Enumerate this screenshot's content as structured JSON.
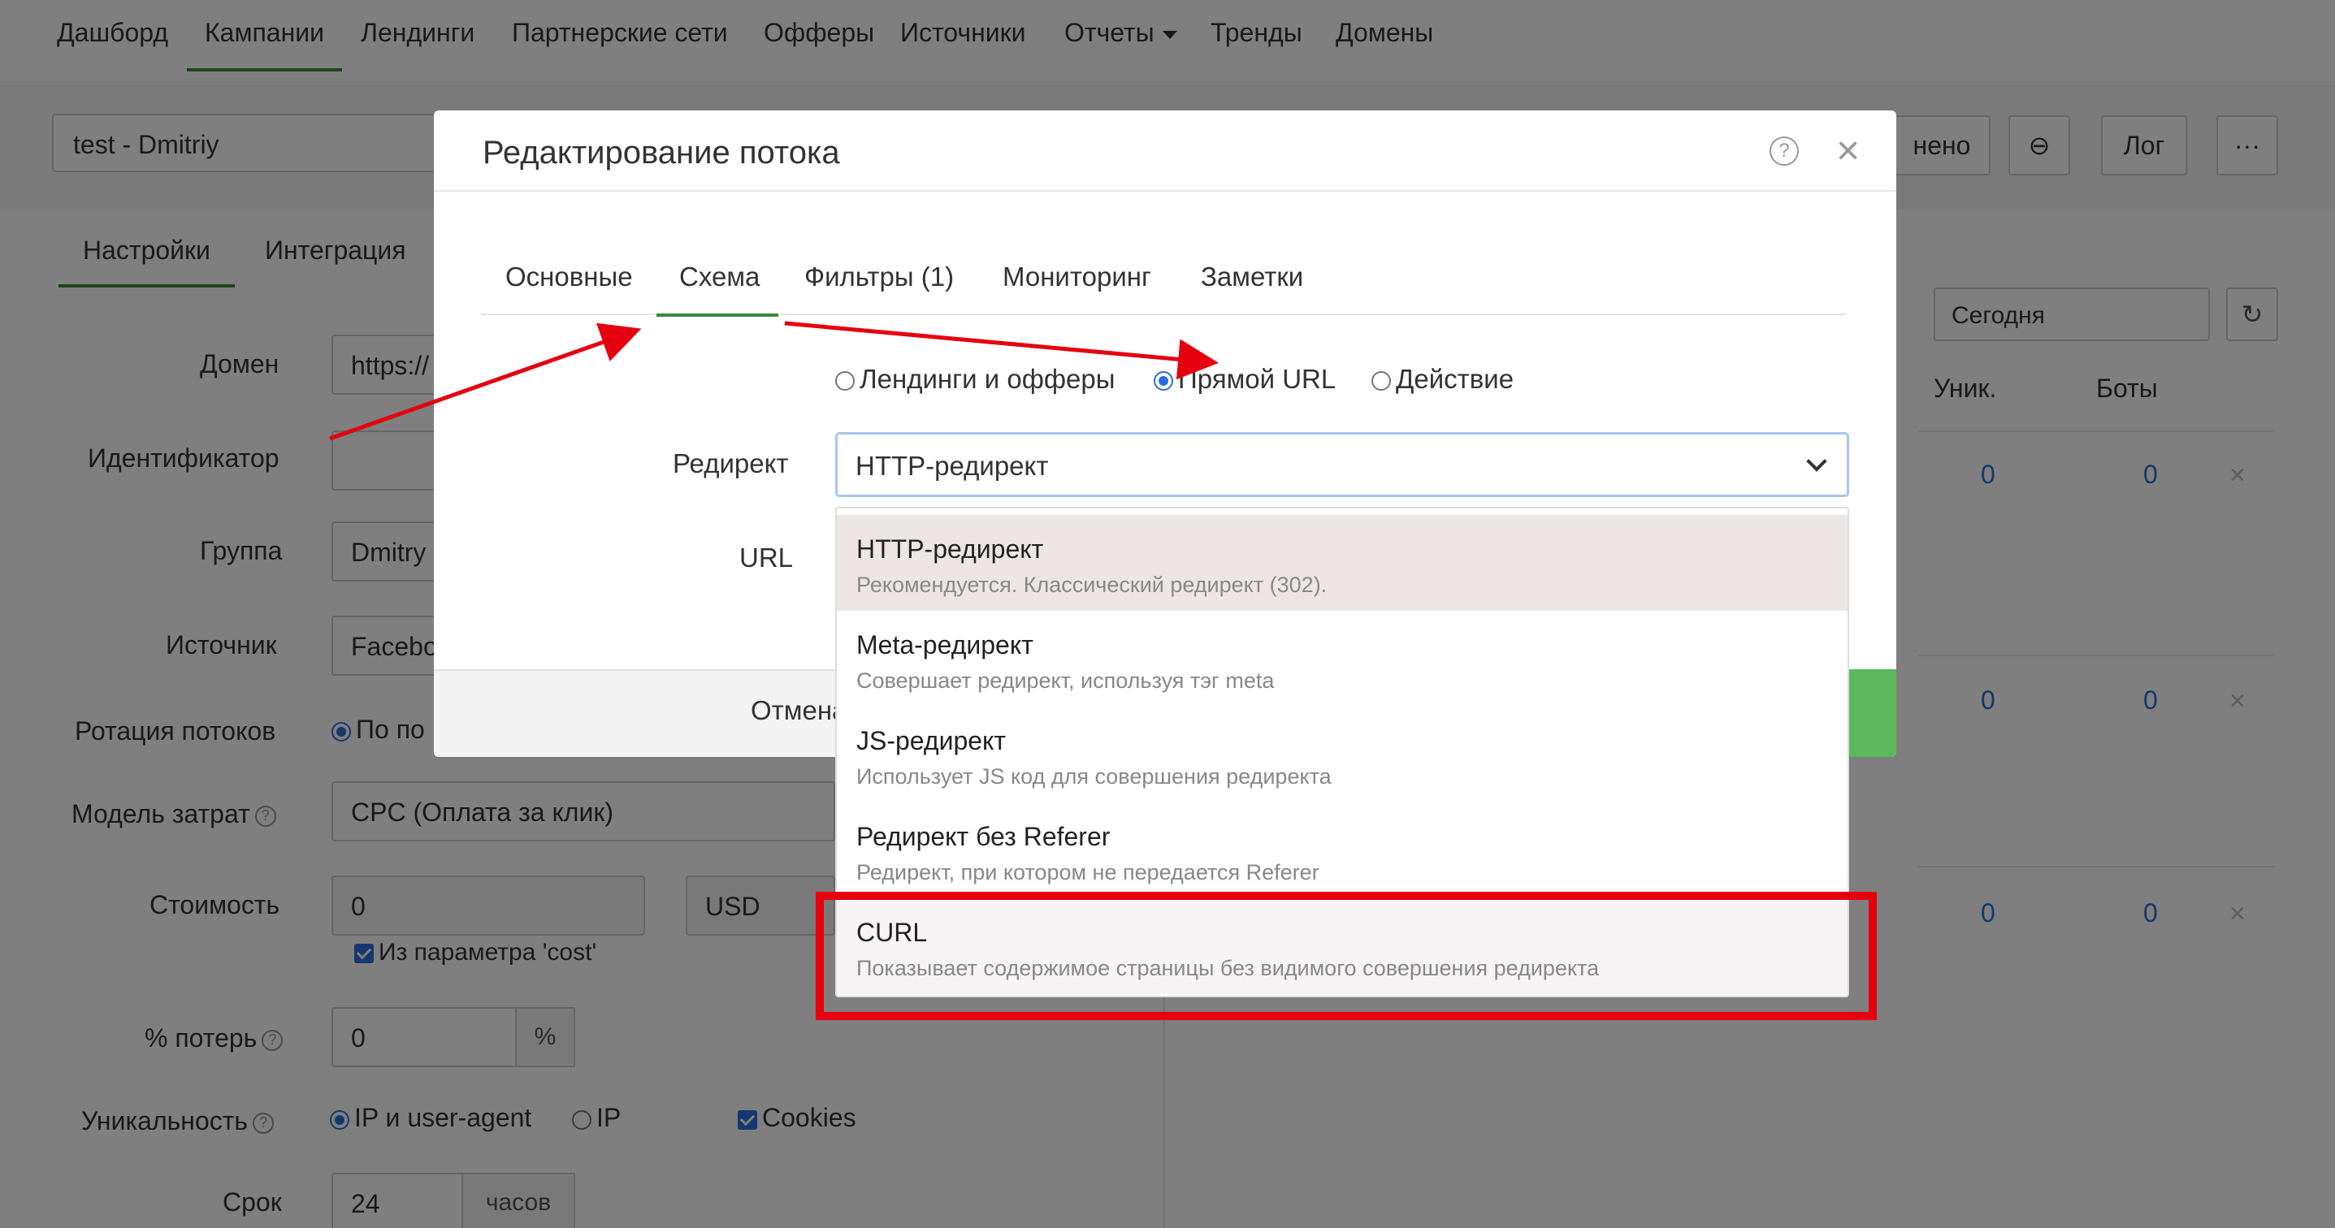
{
  "nav": {
    "items": [
      {
        "label": "Дашборд"
      },
      {
        "label": "Кампании"
      },
      {
        "label": "Лендинги"
      },
      {
        "label": "Партнерские сети"
      },
      {
        "label": "Офферы"
      },
      {
        "label": "Источники"
      },
      {
        "label": "Отчеты"
      },
      {
        "label": "Тренды"
      },
      {
        "label": "Домены"
      }
    ]
  },
  "campaign": {
    "name": "test - Dmitriy",
    "changed_label": "нено",
    "link_icon": "link-icon",
    "log_label": "Лог",
    "more_label": "···"
  },
  "subtabs": {
    "settings": "Настройки",
    "integration": "Интеграция"
  },
  "form": {
    "domain_label": "Домен",
    "domain_value": "https://",
    "identifier_label": "Идентификатор",
    "group_label": "Группа",
    "group_value": "Dmitry",
    "source_label": "Источник",
    "source_value": "Facebo",
    "rotation_label": "Ротация потоков",
    "rotation_value": "По по",
    "cost_model_label": "Модель затрат",
    "cost_model_value": "CPC (Оплата за клик)",
    "cost_label": "Стоимость",
    "cost_value": "0",
    "currency_value": "USD",
    "cost_param_label": "Из параметра 'cost'",
    "loss_label": "% потерь",
    "loss_value": "0",
    "loss_unit": "%",
    "uniq_label": "Уникальность",
    "uniq_ip_ua": "IP и user-agent",
    "uniq_ip": "IP",
    "uniq_cookies": "Cookies",
    "term_label": "Срок",
    "term_value": "24",
    "term_unit": "часов"
  },
  "stats": {
    "period": "Сегодня",
    "col_unique": "Уник.",
    "col_bots": "Боты",
    "zero": "0",
    "remove": "×"
  },
  "modal": {
    "title": "Редактирование потока",
    "help": "?",
    "close": "×",
    "tabs": [
      "Основные",
      "Схема",
      "Фильтры (1)",
      "Мониторинг",
      "Заметки"
    ],
    "scheme_options": [
      "Лендинги и офферы",
      "Прямой URL",
      "Действие"
    ],
    "redirect_label": "Редирект",
    "redirect_value": "HTTP-редирект",
    "url_label": "URL",
    "cancel_label": "Отмена"
  },
  "dropdown": {
    "options": [
      {
        "title": "HTTP-редирект",
        "desc": "Рекомендуется. Классический редирект (302)."
      },
      {
        "title": "Meta-редирект",
        "desc": "Совершает редирект, используя тэг meta"
      },
      {
        "title": "JS-редирект",
        "desc": "Использует JS код для совершения редиректа"
      },
      {
        "title": "Редирект без Referer",
        "desc": "Редирект, при котором не передается Referer"
      },
      {
        "title": "CURL",
        "desc": "Показывает содержимое страницы без видимого совершения редиректа"
      }
    ]
  },
  "colors": {
    "accent_green": "#3a8a3a",
    "link_blue": "#2a6fdb",
    "highlight_red": "#e4000f",
    "save_green": "#5cb85c"
  }
}
